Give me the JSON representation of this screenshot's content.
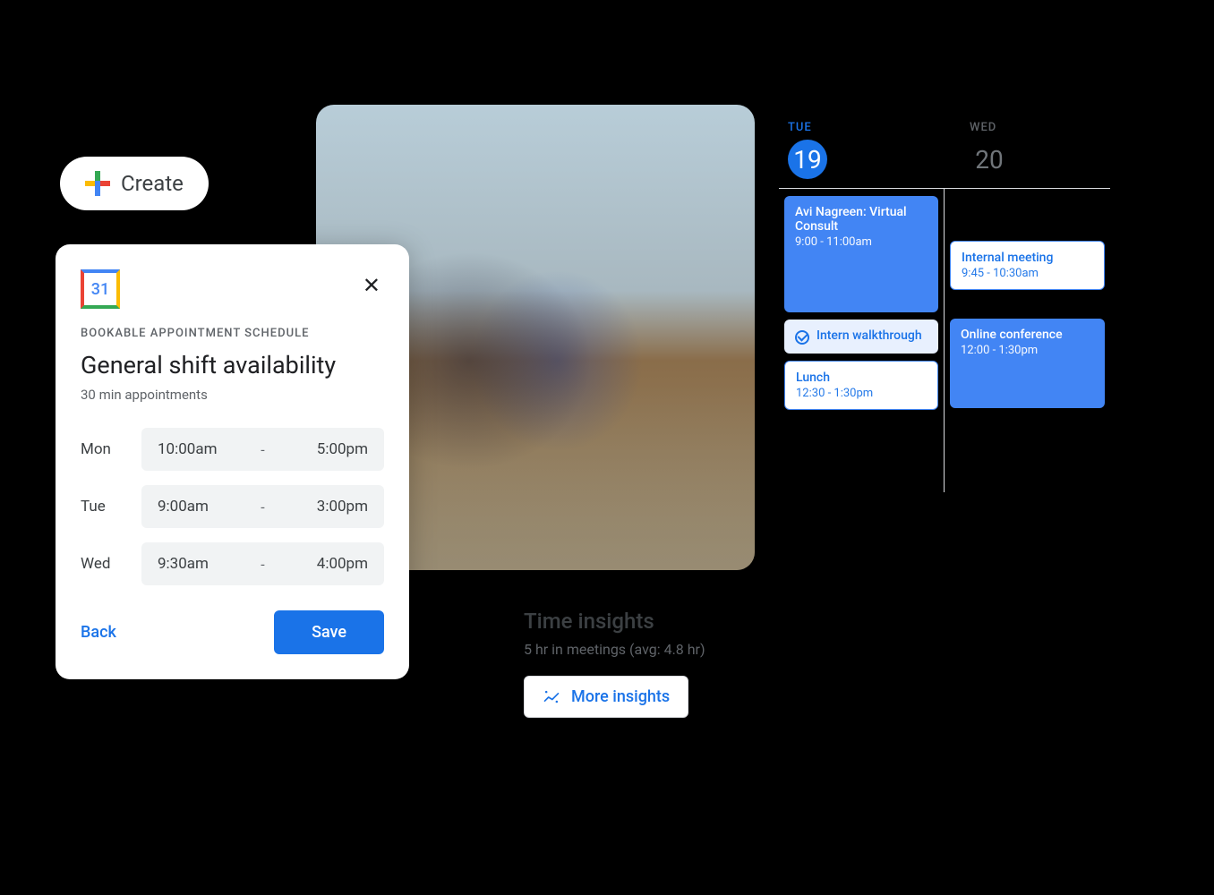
{
  "create": {
    "label": "Create"
  },
  "appointment": {
    "logo_day": "31",
    "eyebrow": "BOOKABLE APPOINTMENT SCHEDULE",
    "title": "General shift availability",
    "subtitle": "30 min appointments",
    "days": [
      {
        "label": "Mon",
        "start": "10:00am",
        "end": "5:00pm"
      },
      {
        "label": "Tue",
        "start": "9:00am",
        "end": "3:00pm"
      },
      {
        "label": "Wed",
        "start": "9:30am",
        "end": "4:00pm"
      }
    ],
    "back_label": "Back",
    "save_label": "Save"
  },
  "calendar": {
    "columns": [
      {
        "dow": "TUE",
        "date": "19",
        "active": true
      },
      {
        "dow": "WED",
        "date": "20",
        "active": false
      }
    ],
    "col1": {
      "event1": {
        "title": "Avi Nagreen: Virtual Consult",
        "time": "9:00 - 11:00am"
      },
      "event2": {
        "title": "Intern walkthrough"
      },
      "event3": {
        "title": "Lunch",
        "time": "12:30 - 1:30pm"
      }
    },
    "col2": {
      "event1": {
        "title": "Internal meeting",
        "time": "9:45 - 10:30am"
      },
      "event2": {
        "title": "Online conference",
        "time": "12:00 - 1:30pm"
      }
    }
  },
  "insights": {
    "title": "Time insights",
    "subtitle": "5 hr in meetings (avg: 4.8 hr)",
    "more_label": "More insights"
  }
}
